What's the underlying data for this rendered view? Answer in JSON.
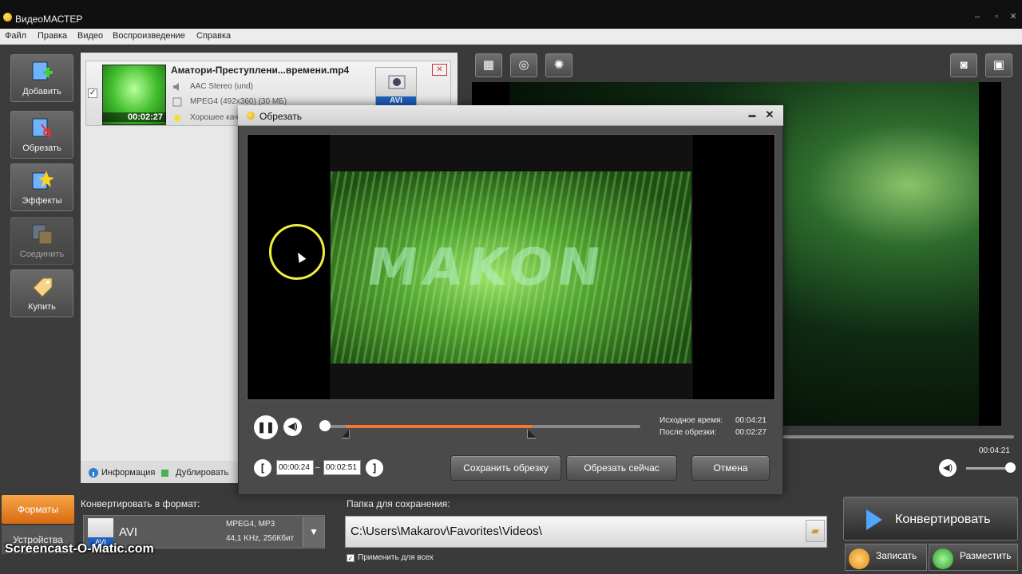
{
  "app": {
    "title": "ВидеоМАСТЕР"
  },
  "menu": [
    "Файл",
    "Правка",
    "Видео",
    "Воспроизведение",
    "Справка"
  ],
  "left_toolbar": {
    "add": "Добавить",
    "trim": "Обрезать",
    "effects": "Эффекты",
    "join": "Соединить",
    "buy": "Купить"
  },
  "file": {
    "name": "Аматори-Преступлени...времени.mp4",
    "audio": "AAC Stereo (und)",
    "video": "MPEG4 (492x360) (30 МБ)",
    "quality": "Хорошее кач",
    "duration": "00:02:27",
    "format_badge": "AVI",
    "checked": "✓"
  },
  "file_bar": {
    "info": "Информация",
    "duplicate": "Дублировать"
  },
  "preview": {
    "total_time": "00:04:21"
  },
  "bottom": {
    "tab_formats": "Форматы",
    "tab_devices": "Устройства",
    "convert_to_label": "Конвертировать в формат:",
    "format_name": "AVI",
    "format_tag": "AVI",
    "format_detail_1": "MPEG4, MP3",
    "format_detail_2": "44,1 KHz, 256Кбит",
    "folder_label": "Папка для сохранения:",
    "folder_path": "C:\\Users\\Makarov\\Favorites\\Videos\\",
    "apply_all": "Применить для всех",
    "convert": "Конвертировать",
    "record": "Записать",
    "place": "Разместить"
  },
  "dialog": {
    "title": "Обрезать",
    "watermark": "MAKON",
    "source_time_label": "Исходное время:",
    "source_time": "00:04:21",
    "after_trim_label": "После обрезки:",
    "after_trim": "00:02:27",
    "start": "00:00:24",
    "end": "00:02:51",
    "dash": "–",
    "save_trim": "Сохранить обрезку",
    "trim_now": "Обрезать сейчас",
    "cancel": "Отмена",
    "selection": {
      "start_fraction": 0.065,
      "end_fraction": 0.656,
      "playhead_fraction": 0.0
    }
  },
  "watermark": "Screencast-O-Matic.com",
  "colors": {
    "accent": "#f07a30",
    "format_tab": "#e8881f",
    "badge_blue": "#1f5fbf",
    "cursor_ring": "#f1f03a"
  }
}
